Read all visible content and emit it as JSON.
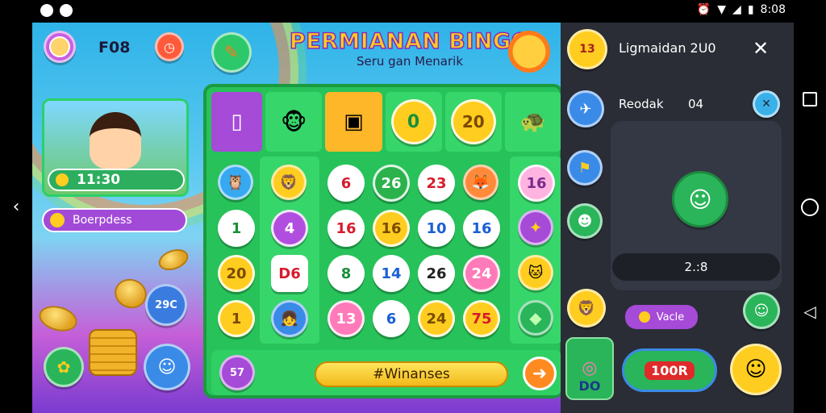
{
  "statusbar": {
    "time": "8:08"
  },
  "game": {
    "top_label": "F08",
    "title": "PERMIANAN BINGO",
    "subtitle": "Seru gan Menarik",
    "timer": "11:30",
    "booster_label": "Boerpdess",
    "card_badge_label": "29C",
    "header_number_1": "0",
    "header_number_2": "20",
    "balls": [
      {
        "value": "6",
        "style": "b-red-t"
      },
      {
        "value": "26",
        "style": "b-green"
      },
      {
        "value": "23",
        "style": "b-red-t"
      },
      {
        "value": "16",
        "style": "b-pink"
      },
      {
        "value": "1",
        "style": "b-white"
      },
      {
        "value": "4",
        "style": "b-purple"
      },
      {
        "value": "16",
        "style": "b-red-t"
      },
      {
        "value": "16",
        "style": "b-yellow"
      },
      {
        "value": "10",
        "style": "b-blue-t"
      },
      {
        "value": "16",
        "style": "b-blue-t"
      },
      {
        "value": "20",
        "style": "b-yellow"
      },
      {
        "value": "D6",
        "style": "b-red-t"
      },
      {
        "value": "8",
        "style": "b-green"
      },
      {
        "value": "14",
        "style": "b-blue-t"
      },
      {
        "value": "26",
        "style": "b-blue-t"
      },
      {
        "value": "24",
        "style": "b-pink"
      },
      {
        "value": "1",
        "style": "b-yellow"
      },
      {
        "value": "13",
        "style": "b-pink"
      },
      {
        "value": "6",
        "style": "b-green"
      },
      {
        "value": "24",
        "style": "b-yellow"
      },
      {
        "value": "75",
        "style": "b-yellow"
      }
    ],
    "win_button": "#Winanses",
    "bottom_badge_label": "57"
  },
  "side": {
    "badge_top": "13",
    "header_title": "Ligmaidan 2U0",
    "row_label": "Reodak",
    "row_value": "04",
    "score_text": "2.:8",
    "mini_pill": "Vacle",
    "level_label": "DO",
    "promo_label": "100R"
  },
  "colors": {
    "accent": "#ffcd1f",
    "board": "#27c25a",
    "panel": "#2a2d36"
  }
}
